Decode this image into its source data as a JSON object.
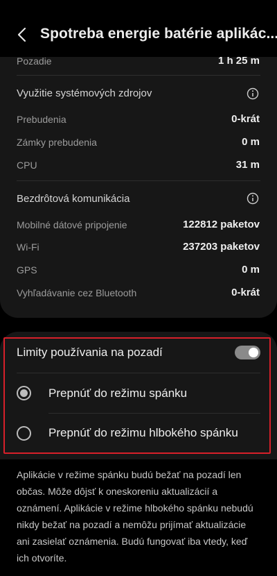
{
  "header": {
    "title": "Spotreba energie batérie aplikác..."
  },
  "usage": {
    "background_label": "Pozadie",
    "background_value": "1 h 25 m",
    "system_section": "Využitie systémových zdrojov",
    "wakeups_label": "Prebudenia",
    "wakeups_value": "0-krát",
    "wakelocks_label": "Zámky prebudenia",
    "wakelocks_value": "0 m",
    "cpu_label": "CPU",
    "cpu_value": "31 m",
    "wireless_section": "Bezdrôtová komunikácia",
    "mobile_label": "Mobilné dátové pripojenie",
    "mobile_value": "122812 paketov",
    "wifi_label": "Wi-Fi",
    "wifi_value": "237203 paketov",
    "gps_label": "GPS",
    "gps_value": "0 m",
    "bt_label": "Vyhľadávanie cez Bluetooth",
    "bt_value": "0-krát"
  },
  "limits": {
    "toggle_label": "Limity používania na pozadí",
    "toggle_on": true,
    "option_sleep": "Prepnúť do režimu spánku",
    "option_deep_sleep": "Prepnúť do režimu hlbokého spánku",
    "selected": "sleep"
  },
  "description": "Aplikácie v režime spánku budú bežať na pozadí len občas. Môže dôjsť k oneskoreniu aktualizácií a oznámení. Aplikácie v režime hlbokého spánku nebudú nikdy bežať na pozadí a nemôžu prijímať aktualizácie ani zasielať oznámenia. Budú fungovať iba vtedy, keď ich otvoríte.",
  "colors": {
    "highlight": "#d8202a",
    "card": "#171717",
    "background": "#000000"
  }
}
